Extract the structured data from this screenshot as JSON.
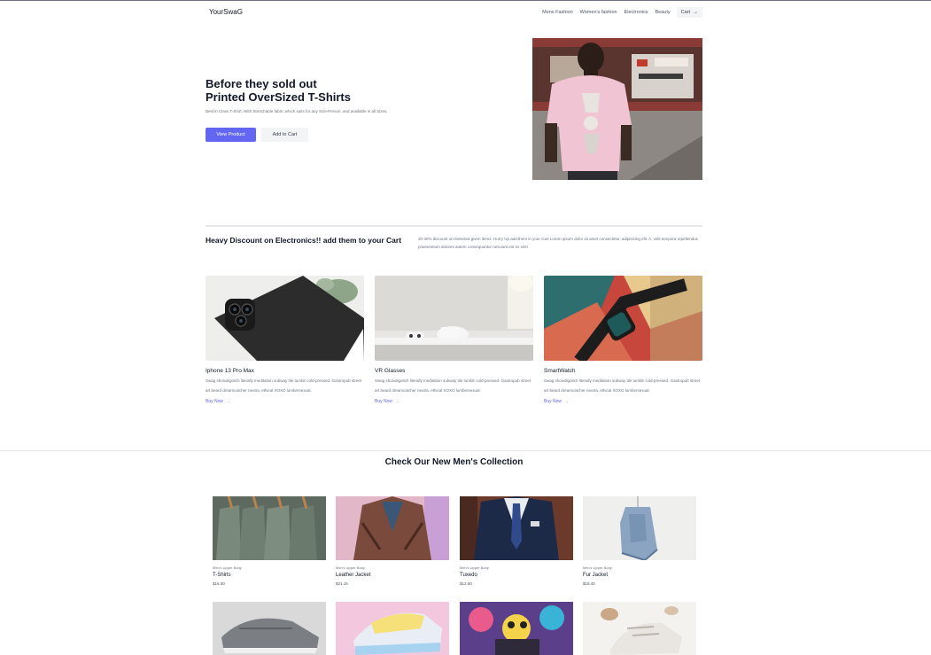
{
  "header": {
    "brand": "YourSwaG",
    "nav": [
      "Mens Fashion",
      "Women's fashion",
      "Electronics",
      "Beauty"
    ],
    "cart_label": "Cart"
  },
  "hero": {
    "title_line1": "Before they sold out",
    "title_line2": "Printed OverSized T-Shirts",
    "description": "Best in Class T-Shirt, With Stretchable fabric which suits for any Size-Person, and available in all Sizes.",
    "primary_button": "View Product",
    "secondary_button": "Add to Cart"
  },
  "discount": {
    "title": "Heavy Discount on Electronics!! add them to your Cart",
    "description": "20-30% discount on Selected given items. Hurry Up add them in your Cart Lorem ipsum dolor sit amet consectetur, adipisicing elit. A, velit tempora repellendus praesentium dolores autem consequuntur nesciunt est ex sint!"
  },
  "electronics": [
    {
      "name": "Iphone 13 Pro Max",
      "description": "Swag shoivdigoitch literally meditation subway tile tumblr cold-pressed. Gastropub street art beard dreamcatcher neutra, ethical XOXO lumbersexual.",
      "link": "Buy Now"
    },
    {
      "name": "VR Glasses",
      "description": "Swag shoivdigoitch literally meditation subway tile tumblr cold-pressed. Gastropub street art beard dreamcatcher neutra, ethical XOXO lumbersexual.",
      "link": "Buy Now"
    },
    {
      "name": "SmartWatch",
      "description": "Swag shoivdigoitch literally meditation subway tile tumblr cold-pressed. Gastropub street art beard dreamcatcher neutra, ethical XOXO lumbersexual.",
      "link": "Buy Now"
    }
  ],
  "collection": {
    "title": "Check Our New Men's Collection",
    "items": [
      {
        "category": "Men's Upper Body",
        "name": "T-Shirts",
        "price": "$16.00"
      },
      {
        "category": "Men's Upper Body",
        "name": "Leather Jacket",
        "price": "$21.15"
      },
      {
        "category": "Men's Upper Body",
        "name": "Tuxedo",
        "price": "$12.00"
      },
      {
        "category": "Men's Upper Body",
        "name": "Fur Jacket",
        "price": "$18.40"
      }
    ]
  },
  "colors": {
    "accent": "#6366f1",
    "secondary_bg": "#f3f4f6"
  },
  "icons": {
    "arrow": "arrow-right-icon"
  }
}
